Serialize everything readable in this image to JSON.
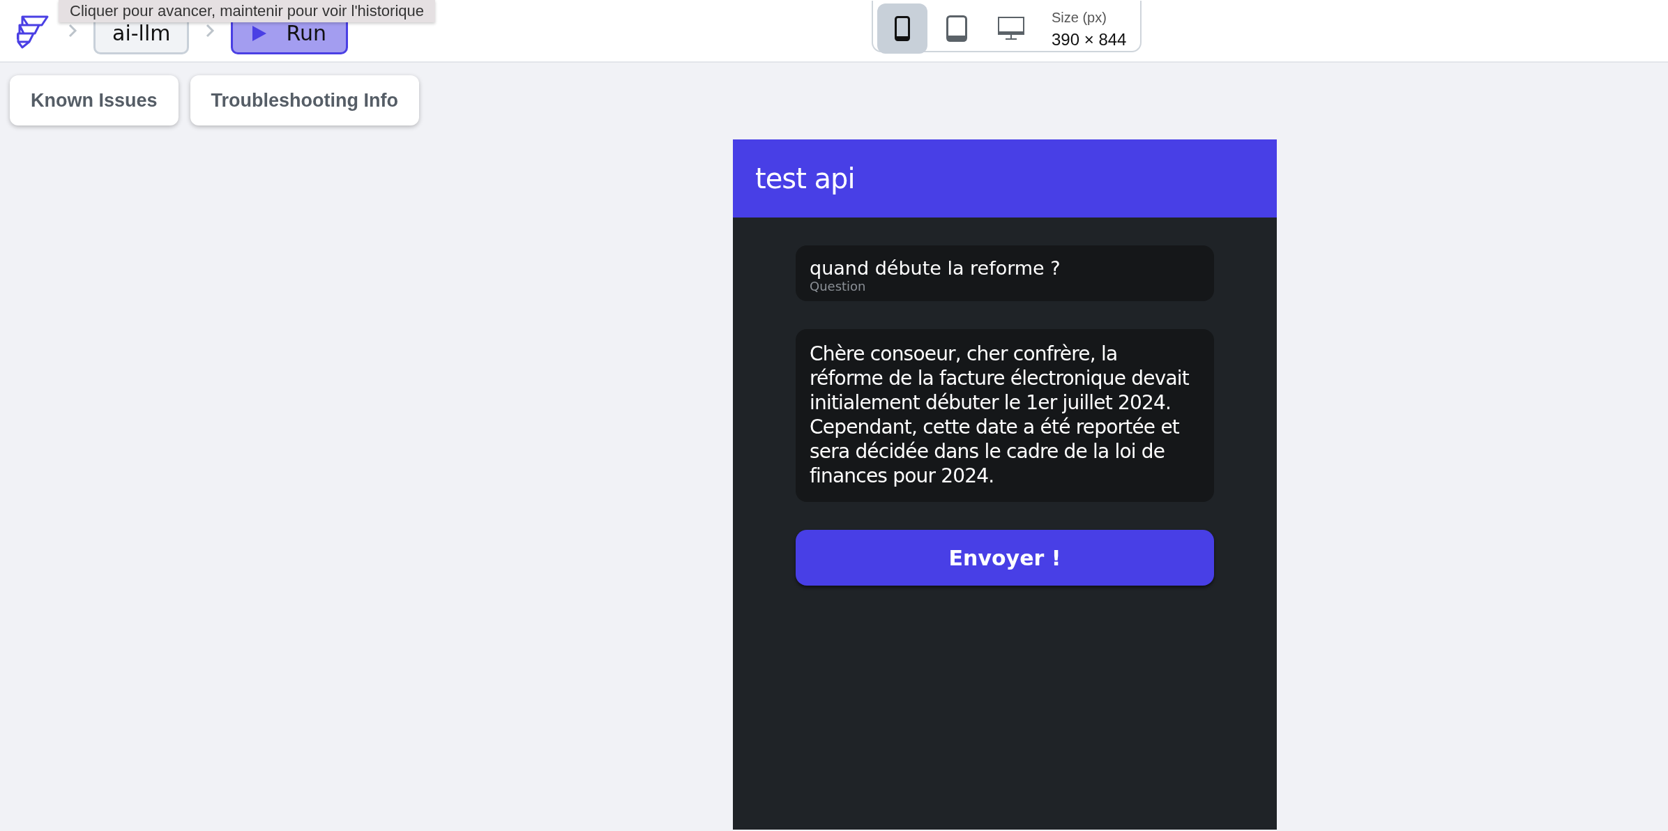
{
  "toolbar": {
    "tooltip": "Cliquer pour avancer, maintenir pour voir l'historique",
    "breadcrumb": "ai-llm",
    "run_button": "Run"
  },
  "device_bar": {
    "devices": [
      {
        "kind": "phone",
        "selected": true
      },
      {
        "kind": "tablet",
        "selected": false
      },
      {
        "kind": "desktop",
        "selected": false
      }
    ],
    "size_label": "Size (px)",
    "size_value": "390 × 844"
  },
  "help_buttons": [
    "Known Issues",
    "Troubleshooting Info"
  ],
  "app": {
    "title": "test api",
    "question": {
      "label": "Question",
      "value": "quand débute la reforme ?"
    },
    "answer": "Chère consoeur, cher confrère, la réforme de la facture électronique devait initialement débuter le 1er juillet 2024. Cependant, cette date a été reportée et sera décidée dans le cadre de la loi de finances pour 2024.",
    "submit": "Envoyer !"
  }
}
